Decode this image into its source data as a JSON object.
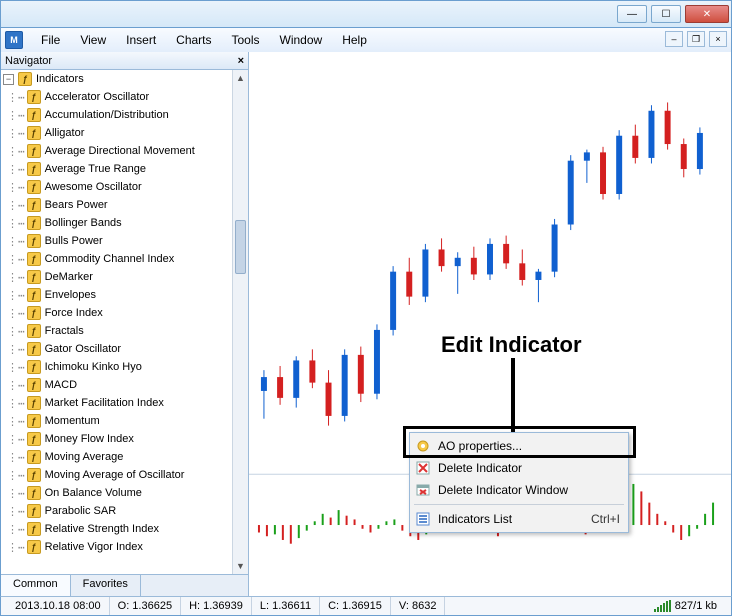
{
  "menus": [
    "File",
    "View",
    "Insert",
    "Charts",
    "Tools",
    "Window",
    "Help"
  ],
  "navigator": {
    "title": "Navigator",
    "root": "Indicators",
    "items": [
      "Accelerator Oscillator",
      "Accumulation/Distribution",
      "Alligator",
      "Average Directional Movement",
      "Average True Range",
      "Awesome Oscillator",
      "Bears Power",
      "Bollinger Bands",
      "Bulls Power",
      "Commodity Channel Index",
      "DeMarker",
      "Envelopes",
      "Force Index",
      "Fractals",
      "Gator Oscillator",
      "Ichimoku Kinko Hyo",
      "MACD",
      "Market Facilitation Index",
      "Momentum",
      "Money Flow Index",
      "Moving Average",
      "Moving Average of Oscillator",
      "On Balance Volume",
      "Parabolic SAR",
      "Relative Strength Index",
      "Relative Vigor Index"
    ],
    "tabs": [
      "Common",
      "Favorites"
    ]
  },
  "context_menu": {
    "items": [
      {
        "icon": "gear",
        "label": "AO properties...",
        "hotkey": ""
      },
      {
        "icon": "delete",
        "label": "Delete Indicator",
        "hotkey": ""
      },
      {
        "icon": "delete-window",
        "label": "Delete Indicator Window",
        "hotkey": ""
      }
    ],
    "sep_after": 2,
    "items2": [
      {
        "icon": "list",
        "label": "Indicators List",
        "hotkey": "Ctrl+I"
      }
    ]
  },
  "annotation": {
    "label": "Edit Indicator"
  },
  "status": {
    "datetime": "2013.10.18 08:00",
    "o": "O: 1.36625",
    "h": "H: 1.36939",
    "l": "L: 1.36611",
    "c": "C: 1.36915",
    "v": "V: 8632",
    "net": "827/1 kb"
  },
  "chart_data": {
    "type": "candlestick",
    "note": "approximate OHLC values estimated from pixels; y-scale ~1.350–1.374",
    "series": [
      {
        "o": 1.353,
        "h": 1.3545,
        "l": 1.351,
        "c": 1.354,
        "dir": "up"
      },
      {
        "o": 1.354,
        "h": 1.3548,
        "l": 1.352,
        "c": 1.3525,
        "dir": "down"
      },
      {
        "o": 1.3525,
        "h": 1.3555,
        "l": 1.3518,
        "c": 1.3552,
        "dir": "up"
      },
      {
        "o": 1.3552,
        "h": 1.356,
        "l": 1.3532,
        "c": 1.3536,
        "dir": "down"
      },
      {
        "o": 1.3536,
        "h": 1.3545,
        "l": 1.3505,
        "c": 1.3512,
        "dir": "down"
      },
      {
        "o": 1.3512,
        "h": 1.356,
        "l": 1.3508,
        "c": 1.3556,
        "dir": "up"
      },
      {
        "o": 1.3556,
        "h": 1.3562,
        "l": 1.3522,
        "c": 1.3528,
        "dir": "down"
      },
      {
        "o": 1.3528,
        "h": 1.3578,
        "l": 1.3524,
        "c": 1.3574,
        "dir": "up"
      },
      {
        "o": 1.3574,
        "h": 1.362,
        "l": 1.357,
        "c": 1.3616,
        "dir": "up"
      },
      {
        "o": 1.3616,
        "h": 1.3626,
        "l": 1.3592,
        "c": 1.3598,
        "dir": "down"
      },
      {
        "o": 1.3598,
        "h": 1.3636,
        "l": 1.3594,
        "c": 1.3632,
        "dir": "up"
      },
      {
        "o": 1.3632,
        "h": 1.364,
        "l": 1.3616,
        "c": 1.362,
        "dir": "down"
      },
      {
        "o": 1.362,
        "h": 1.363,
        "l": 1.36,
        "c": 1.3626,
        "dir": "up"
      },
      {
        "o": 1.3626,
        "h": 1.3634,
        "l": 1.361,
        "c": 1.3614,
        "dir": "down"
      },
      {
        "o": 1.3614,
        "h": 1.364,
        "l": 1.361,
        "c": 1.3636,
        "dir": "up"
      },
      {
        "o": 1.3636,
        "h": 1.3642,
        "l": 1.3618,
        "c": 1.3622,
        "dir": "down"
      },
      {
        "o": 1.3622,
        "h": 1.3632,
        "l": 1.3606,
        "c": 1.361,
        "dir": "down"
      },
      {
        "o": 1.361,
        "h": 1.3618,
        "l": 1.3594,
        "c": 1.3616,
        "dir": "up"
      },
      {
        "o": 1.3616,
        "h": 1.3654,
        "l": 1.3612,
        "c": 1.365,
        "dir": "up"
      },
      {
        "o": 1.365,
        "h": 1.37,
        "l": 1.3646,
        "c": 1.3696,
        "dir": "up"
      },
      {
        "o": 1.3696,
        "h": 1.3704,
        "l": 1.368,
        "c": 1.3702,
        "dir": "up"
      },
      {
        "o": 1.3702,
        "h": 1.3706,
        "l": 1.3668,
        "c": 1.3672,
        "dir": "down"
      },
      {
        "o": 1.3672,
        "h": 1.3718,
        "l": 1.3668,
        "c": 1.3714,
        "dir": "up"
      },
      {
        "o": 1.3714,
        "h": 1.3722,
        "l": 1.3694,
        "c": 1.3698,
        "dir": "down"
      },
      {
        "o": 1.3698,
        "h": 1.3736,
        "l": 1.3694,
        "c": 1.3732,
        "dir": "up"
      },
      {
        "o": 1.3732,
        "h": 1.3738,
        "l": 1.3704,
        "c": 1.3708,
        "dir": "down"
      },
      {
        "o": 1.3708,
        "h": 1.3712,
        "l": 1.3684,
        "c": 1.369,
        "dir": "down"
      },
      {
        "o": 1.369,
        "h": 1.372,
        "l": 1.3686,
        "c": 1.3716,
        "dir": "up"
      }
    ],
    "oscillator": {
      "type": "awesome-oscillator",
      "values": [
        -4,
        -6,
        -5,
        -8,
        -10,
        -7,
        -3,
        2,
        6,
        4,
        8,
        5,
        3,
        -2,
        -4,
        -2,
        2,
        3,
        -3,
        -6,
        -8,
        -5,
        -2,
        4,
        8,
        12,
        14,
        10,
        6,
        -3,
        -6,
        -4,
        4,
        8,
        12,
        16,
        18,
        14,
        8,
        4,
        -2,
        -5,
        -3,
        4,
        10,
        16,
        20,
        22,
        18,
        12,
        6,
        2,
        -4,
        -8,
        -6,
        -2,
        6,
        12
      ]
    }
  }
}
